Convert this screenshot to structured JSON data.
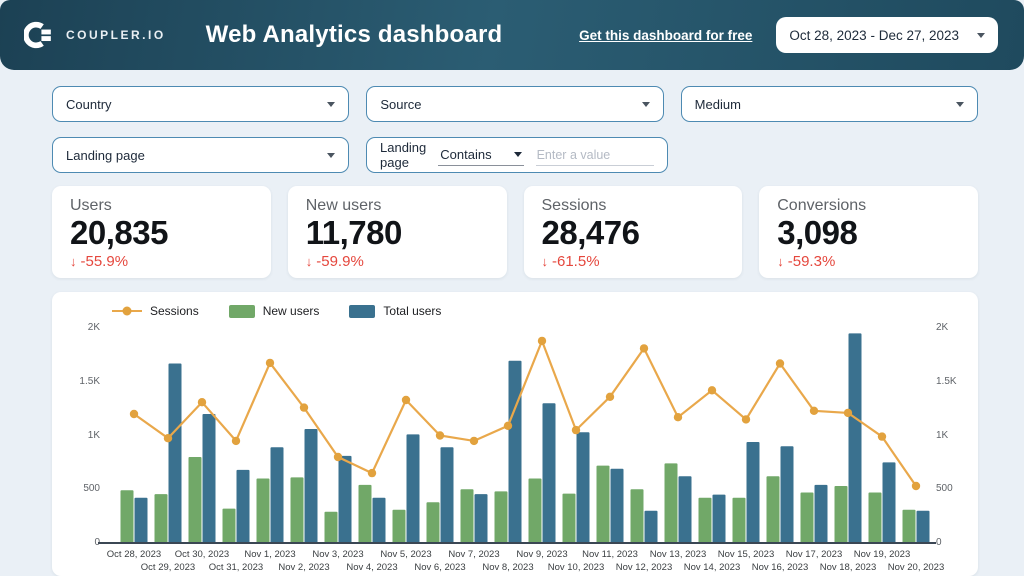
{
  "header": {
    "logo_text": "COUPLER.IO",
    "title": "Web Analytics dashboard",
    "link": "Get this dashboard for free",
    "date_range": "Oct 28, 2023 - Dec 27, 2023"
  },
  "filters": {
    "country": "Country",
    "source": "Source",
    "medium": "Medium",
    "landing_page": "Landing page",
    "landing_page_filter": {
      "label": "Landing page",
      "operator": "Contains",
      "placeholder": "Enter a value"
    }
  },
  "kpis": [
    {
      "label": "Users",
      "value": "20,835",
      "delta": "-55.9%"
    },
    {
      "label": "New users",
      "value": "11,780",
      "delta": "-59.9%"
    },
    {
      "label": "Sessions",
      "value": "28,476",
      "delta": "-61.5%"
    },
    {
      "label": "Conversions",
      "value": "3,098",
      "delta": "-59.3%"
    }
  ],
  "chart_data": {
    "type": "bar",
    "subtype": "grouped bars with line overlay",
    "legend": [
      "Sessions",
      "New users",
      "Total users"
    ],
    "colors": {
      "sessions": "#E2A23E",
      "sessions_line": "#E9A84B",
      "new_users": "#71A868",
      "total_users": "#3A718F",
      "delta_red": "#E5473D",
      "header_bg": "#234F64",
      "filter_border": "#4D8AB2",
      "page_bg": "#EAF0F6"
    },
    "x": [
      "Oct 28, 2023",
      "Oct 29, 2023",
      "Oct 30, 2023",
      "Oct 31, 2023",
      "Nov 1, 2023",
      "Nov 2, 2023",
      "Nov 3, 2023",
      "Nov 4, 2023",
      "Nov 5, 2023",
      "Nov 6, 2023",
      "Nov 7, 2023",
      "Nov 8, 2023",
      "Nov 9, 2023",
      "Nov 10, 2023",
      "Nov 11, 2023",
      "Nov 12, 2023",
      "Nov 13, 2023",
      "Nov 14, 2023",
      "Nov 15, 2023",
      "Nov 16, 2023",
      "Nov 17, 2023",
      "Nov 18, 2023",
      "Nov 19, 2023",
      "Nov 20, 2023"
    ],
    "series": [
      {
        "name": "Sessions",
        "type": "line",
        "values": [
          1200,
          975,
          1310,
          950,
          1675,
          1260,
          800,
          650,
          1330,
          1000,
          950,
          1090,
          1880,
          1050,
          1360,
          1810,
          1170,
          1420,
          1150,
          1670,
          1230,
          1210,
          990,
          530
        ]
      },
      {
        "name": "New users",
        "type": "bar",
        "values": [
          490,
          455,
          800,
          320,
          600,
          610,
          290,
          540,
          310,
          380,
          500,
          480,
          600,
          460,
          720,
          500,
          740,
          420,
          420,
          620,
          470,
          530,
          470,
          310
        ]
      },
      {
        "name": "Total users",
        "type": "bar",
        "values": [
          420,
          1670,
          1200,
          680,
          890,
          1060,
          810,
          420,
          1010,
          890,
          455,
          1695,
          1300,
          1030,
          690,
          300,
          620,
          450,
          940,
          900,
          540,
          1950,
          750,
          300
        ]
      }
    ],
    "ylim": [
      0,
      2000
    ],
    "y_ticks": [
      {
        "v": 0,
        "label": "0"
      },
      {
        "v": 500,
        "label": "500"
      },
      {
        "v": 1000,
        "label": "1K"
      },
      {
        "v": 1500,
        "label": "1.5K"
      },
      {
        "v": 2000,
        "label": "2K"
      }
    ],
    "grid": "off",
    "legend_position": "top-left",
    "y_axis": "both sides"
  }
}
